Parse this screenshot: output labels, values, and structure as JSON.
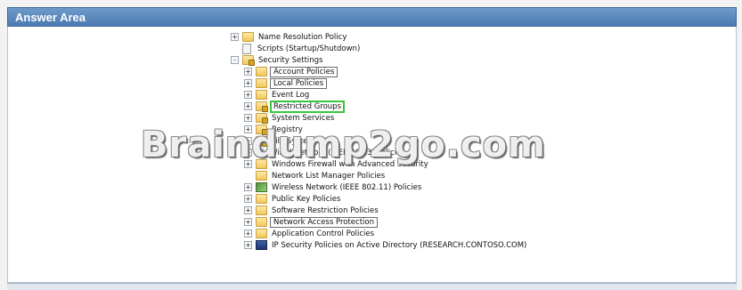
{
  "title": "Answer Area",
  "watermark": "Braindump2go.com",
  "tree": {
    "items": [
      {
        "label": "Name Resolution Policy",
        "expander": "+",
        "icon": "folder-icon"
      },
      {
        "label": "Scripts (Startup/Shutdown)",
        "expander": "",
        "icon": "script-document-icon"
      },
      {
        "label": "Security Settings",
        "expander": "-",
        "icon": "security-folder-icon"
      },
      {
        "label": "Account Policies",
        "expander": "+",
        "icon": "folder-icon"
      },
      {
        "label": "Local Policies",
        "expander": "+",
        "icon": "folder-icon"
      },
      {
        "label": "Event Log",
        "expander": "+",
        "icon": "folder-icon"
      },
      {
        "label": "Restricted Groups",
        "expander": "+",
        "icon": "lock-folder-icon"
      },
      {
        "label": "System Services",
        "expander": "+",
        "icon": "lock-folder-icon"
      },
      {
        "label": "Registry",
        "expander": "+",
        "icon": "lock-folder-icon"
      },
      {
        "label": "File System",
        "expander": "+",
        "icon": "lock-folder-icon"
      },
      {
        "label": "Wired Network (IEEE 802.3) Policies",
        "expander": "+",
        "icon": "network-icon"
      },
      {
        "label": "Windows Firewall with Advanced Security",
        "expander": "+",
        "icon": "folder-icon"
      },
      {
        "label": "Network List Manager Policies",
        "expander": "",
        "icon": "folder-icon"
      },
      {
        "label": "Wireless Network (IEEE 802.11) Policies",
        "expander": "+",
        "icon": "wireless-icon"
      },
      {
        "label": "Public Key Policies",
        "expander": "+",
        "icon": "folder-icon"
      },
      {
        "label": "Software Restriction Policies",
        "expander": "+",
        "icon": "folder-icon"
      },
      {
        "label": "Network Access Protection",
        "expander": "+",
        "icon": "folder-icon"
      },
      {
        "label": "Application Control Policies",
        "expander": "+",
        "icon": "folder-icon"
      },
      {
        "label": "IP Security Policies on Active Directory (RESEARCH.CONTOSO.COM)",
        "expander": "+",
        "icon": "ip-security-icon"
      }
    ]
  },
  "colors": {
    "title_bar": "#5586bd",
    "highlight_box": "#3cc43c"
  }
}
